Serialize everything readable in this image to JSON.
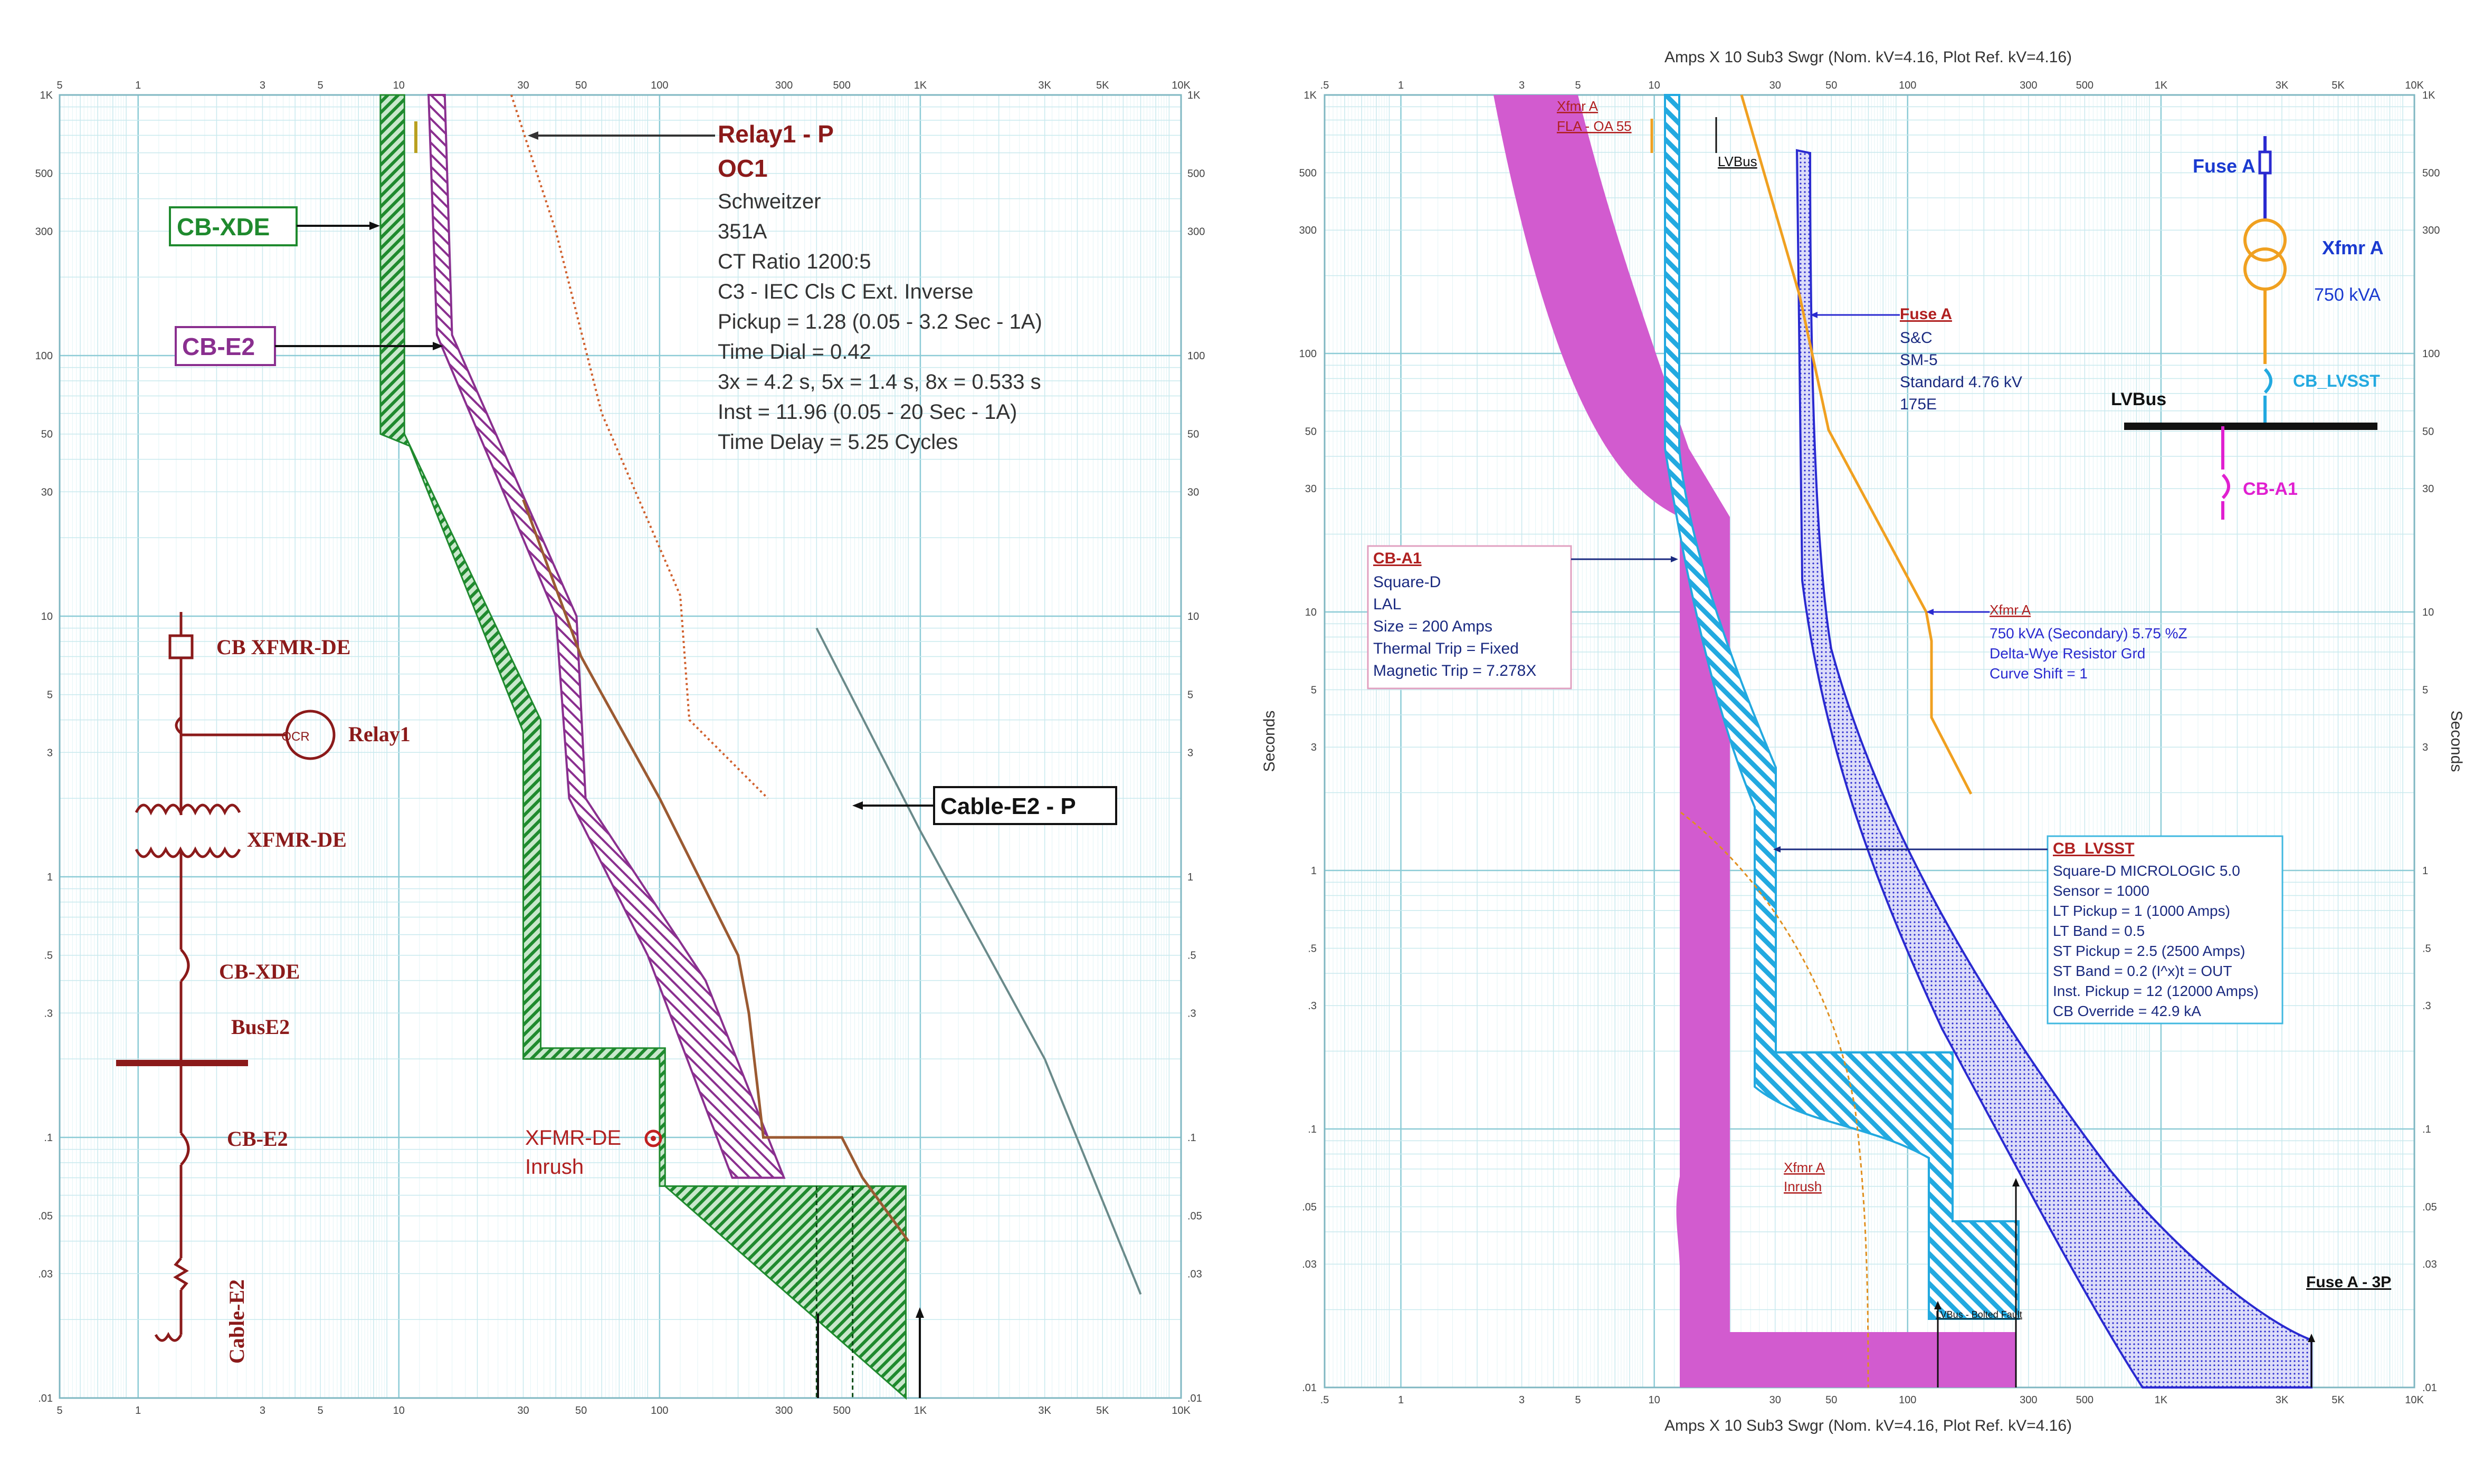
{
  "colors": {
    "grid_minor": "#bfe6ec",
    "grid_major": "#8ccbd6",
    "frame": "#7fb7c2",
    "green": "#1f8a2e",
    "purple": "#8a2f8f",
    "relay_brown": "#c0602d",
    "brown": "#8b4a2a",
    "gray_line": "#6a8a8a",
    "dark_red": "#8b1a1a",
    "magenta": "#d25bcf",
    "cyan": "#22a9e0",
    "blue": "#2a2ad0",
    "orange": "#f0a020",
    "label_red": "#b02020"
  },
  "chart_data": [
    {
      "type": "line",
      "x_scale": "log",
      "y_scale": "log",
      "xlim": [
        0.5,
        10000
      ],
      "ylim": [
        0.01,
        1000
      ],
      "x_ticks": [
        "5",
        "1",
        "3",
        "5",
        "10",
        "30",
        "50",
        "100",
        "300",
        "500",
        "1K",
        "3K",
        "5K",
        "10K"
      ],
      "y_ticks": [
        "1K",
        "500",
        "300",
        "100",
        "50",
        "30",
        "10",
        "5",
        "3",
        "1",
        ".5",
        ".3",
        ".1",
        ".05",
        ".03",
        ".01"
      ],
      "grid": true,
      "series": [
        {
          "name": "CB-XDE",
          "style": "band",
          "lower": [
            [
              8.5,
              1000
            ],
            [
              8.5,
              50
            ],
            [
              11,
              45
            ],
            [
              30,
              3.6
            ],
            [
              30,
              0.2
            ],
            [
              100,
              0.2
            ],
            [
              100,
              0.065
            ],
            [
              880,
              0.065
            ],
            [
              880,
              0.01
            ]
          ],
          "upper": [
            [
              10.5,
              1000
            ],
            [
              10.5,
              50
            ],
            [
              35,
              4
            ],
            [
              35,
              0.22
            ],
            [
              105,
              0.22
            ],
            [
              105,
              0.065
            ]
          ]
        },
        {
          "name": "CB-E2",
          "style": "band",
          "lower": [
            [
              13,
              1000
            ],
            [
              14,
              120
            ],
            [
              40,
              10
            ],
            [
              45,
              2
            ],
            [
              90,
              0.5
            ],
            [
              190,
              0.07
            ],
            [
              240,
              0.07
            ]
          ],
          "upper": [
            [
              15,
              1000
            ],
            [
              16,
              120
            ],
            [
              48,
              10
            ],
            [
              52,
              2
            ],
            [
              150,
              0.4
            ],
            [
              300,
              0.07
            ]
          ]
        },
        {
          "name": "Relay1 - P",
          "style": "dotted",
          "points": [
            [
              27,
              1000
            ],
            [
              40,
              300
            ],
            [
              60,
              60
            ],
            [
              120,
              12
            ],
            [
              130,
              4
            ],
            [
              260,
              2
            ]
          ]
        },
        {
          "name": "",
          "style": "solid",
          "points": [
            [
              30,
              28
            ],
            [
              50,
              7
            ],
            [
              100,
              2
            ],
            [
              200,
              0.5
            ],
            [
              220,
              0.3
            ],
            [
              250,
              0.1
            ],
            [
              500,
              0.1
            ],
            [
              600,
              0.07
            ],
            [
              900,
              0.04
            ]
          ]
        },
        {
          "name": "Cable-E2 - P",
          "style": "solid",
          "points": [
            [
              400,
              9
            ],
            [
              1000,
              1.5
            ],
            [
              3000,
              0.2
            ],
            [
              7000,
              0.025
            ]
          ]
        }
      ]
    },
    {
      "type": "line",
      "x_scale": "log",
      "y_scale": "log",
      "xlim": [
        0.5,
        10000
      ],
      "ylim": [
        0.01,
        1000
      ],
      "x_ticks": [
        ".5",
        "1",
        "3",
        "5",
        "10",
        "30",
        "50",
        "100",
        "300",
        "500",
        "1K",
        "3K",
        "5K",
        "10K"
      ],
      "y_ticks": [
        "1K",
        "500",
        "300",
        "100",
        "50",
        "30",
        "10",
        "5",
        "3",
        "1",
        ".5",
        ".3",
        ".1",
        ".05",
        ".03",
        ".01"
      ],
      "grid": true,
      "series": [
        {
          "name": "CB-A1",
          "style": "band"
        },
        {
          "name": "CB_LVSST",
          "style": "band"
        },
        {
          "name": "Fuse A",
          "style": "band"
        },
        {
          "name": "Xfmr A",
          "style": "solid"
        }
      ]
    }
  ],
  "left_chart": {
    "relay_title_1": "Relay1 - P",
    "relay_title_2": "OC1",
    "relay_lines": [
      "Schweitzer",
      "351A",
      "CT Ratio 1200:5",
      "C3 - IEC Cls C Ext. Inverse",
      "Pickup = 1.28 (0.05 - 3.2  Sec - 1A)",
      "Time Dial = 0.42",
      "3x = 4.2 s, 5x = 1.4 s, 8x = 0.533 s",
      "Inst = 11.96 (0.05 - 20  Sec - 1A)",
      "Time Delay = 5.25 Cycles"
    ],
    "cb_xde_tag": "CB-XDE",
    "cb_e2_tag": "CB-E2",
    "cable_tag": "Cable-E2 - P",
    "inrush_1": "XFMR-DE",
    "inrush_2": "Inrush",
    "oneline": {
      "cb_xfmr": "CB XFMR-DE",
      "ocr": "OCR",
      "relay": "Relay1",
      "xfmr": "XFMR-DE",
      "cb_xde": "CB-XDE",
      "bus": "BusE2",
      "cb_e2": "CB-E2",
      "cable": "Cable-E2"
    }
  },
  "right_chart": {
    "header": "Amps  X  10   Sub3 Swgr (Nom. kV=4.16, Plot Ref. kV=4.16)",
    "footer": "Amps  X  10   Sub3 Swgr (Nom. kV=4.16, Plot Ref. kV=4.16)",
    "y_label_left": "Seconds",
    "y_label_right": "Seconds",
    "xfmr_fla_1": "Xfmr A",
    "xfmr_fla_2": "FLA - OA 55",
    "lvbus_tag": "LVBus",
    "fuse_box": {
      "title": "Fuse A",
      "lines": [
        "S&C",
        "SM-5",
        "Standard  4.76 kV",
        "175E"
      ]
    },
    "cba1_box": {
      "title": "CB-A1",
      "lines": [
        "Square-D",
        "LAL",
        "Size = 200 Amps",
        "Thermal Trip = Fixed",
        "Magnetic Trip = 7.278X"
      ]
    },
    "xfmr_box": {
      "title": "Xfmr A",
      "lines": [
        "750 kVA (Secondary)  5.75 %Z",
        "Delta-Wye Resistor Grd",
        "Curve Shift = 1"
      ]
    },
    "lvsst_box": {
      "title": "CB_LVSST",
      "lines": [
        "Square-D  MICROLOGIC 5.0",
        "Sensor = 1000",
        "LT Pickup = 1 (1000 Amps)",
        "LT Band = 0.5",
        "ST Pickup = 2.5 (2500 Amps)",
        "ST Band = 0.2  (I^x)t = OUT",
        "Inst. Pickup = 12 (12000 Amps)",
        "CB Override = 42.9 kA"
      ]
    },
    "inrush_1": "Xfmr A",
    "inrush_2": "Inrush",
    "fault_small": "LVBus - Bolted Fault",
    "fuse3p": "Fuse A - 3P",
    "oneline": {
      "fuse": "Fuse A",
      "xfmr": "Xfmr A",
      "kva": "750 kVA",
      "cb_lvsst": "CB_LVSST",
      "lvbus": "LVBus",
      "cba1": "CB-A1"
    }
  }
}
